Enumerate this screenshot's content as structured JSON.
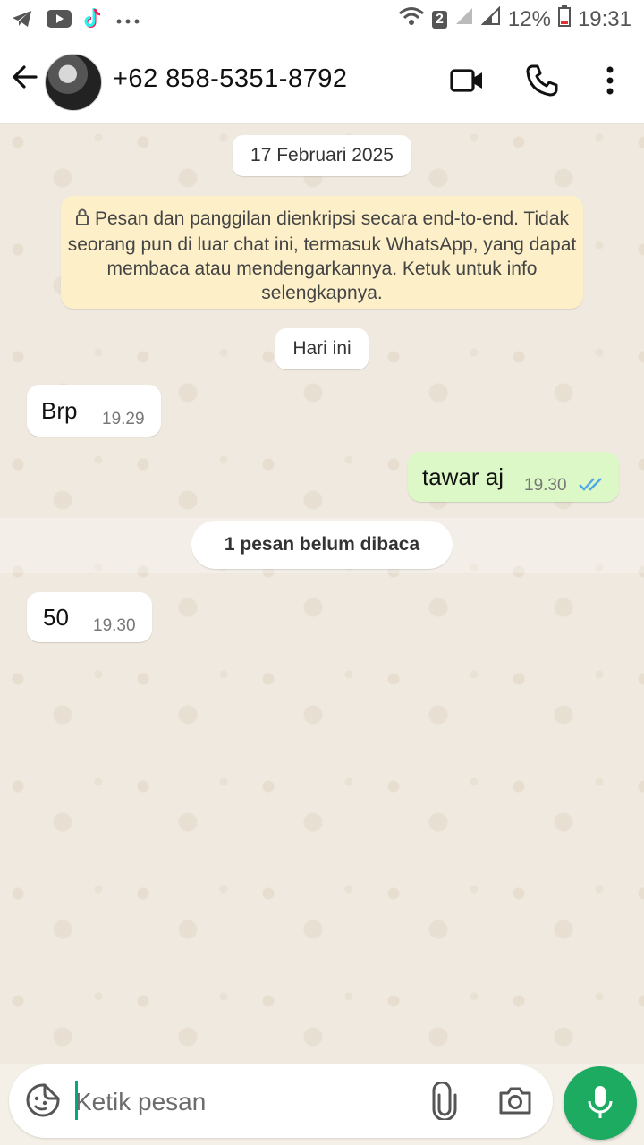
{
  "status_bar": {
    "notification_icons": [
      "telegram-icon",
      "youtube-icon",
      "tiktok-icon",
      "more-dots-icon"
    ],
    "sim_badge": "2",
    "battery": "12%",
    "time": "19:31"
  },
  "header": {
    "contact": "+62 858-5351-8792",
    "icons": [
      "back-arrow-icon",
      "video-call-icon",
      "phone-icon",
      "menu-icon"
    ]
  },
  "chat": {
    "date_pill": "17 Februari 2025",
    "encryption_notice": "Pesan dan panggilan dienkripsi secara end-to-end. Tidak seorang pun di luar chat ini, termasuk WhatsApp, yang dapat membaca atau mendengarkannya. Ketuk untuk info selengkapnya.",
    "today_pill": "Hari ini",
    "unread_banner": "1 pesan belum dibaca",
    "messages": [
      {
        "direction": "in",
        "text": "Brp",
        "time": "19.29"
      },
      {
        "direction": "out",
        "text": "tawar aj",
        "time": "19.30",
        "status": "read"
      },
      {
        "direction": "in",
        "text": "50",
        "time": "19.30"
      }
    ]
  },
  "composer": {
    "placeholder": "Ketik pesan",
    "icons": [
      "sticker-icon",
      "attach-icon",
      "camera-icon",
      "mic-icon"
    ]
  },
  "colors": {
    "accent": "#1daa61",
    "outgoing_bubble": "#dcf8c6",
    "read_ticks": "#4fa9e8",
    "encryption_bg": "#fdf0c9",
    "chat_bg": "#efe9df"
  }
}
